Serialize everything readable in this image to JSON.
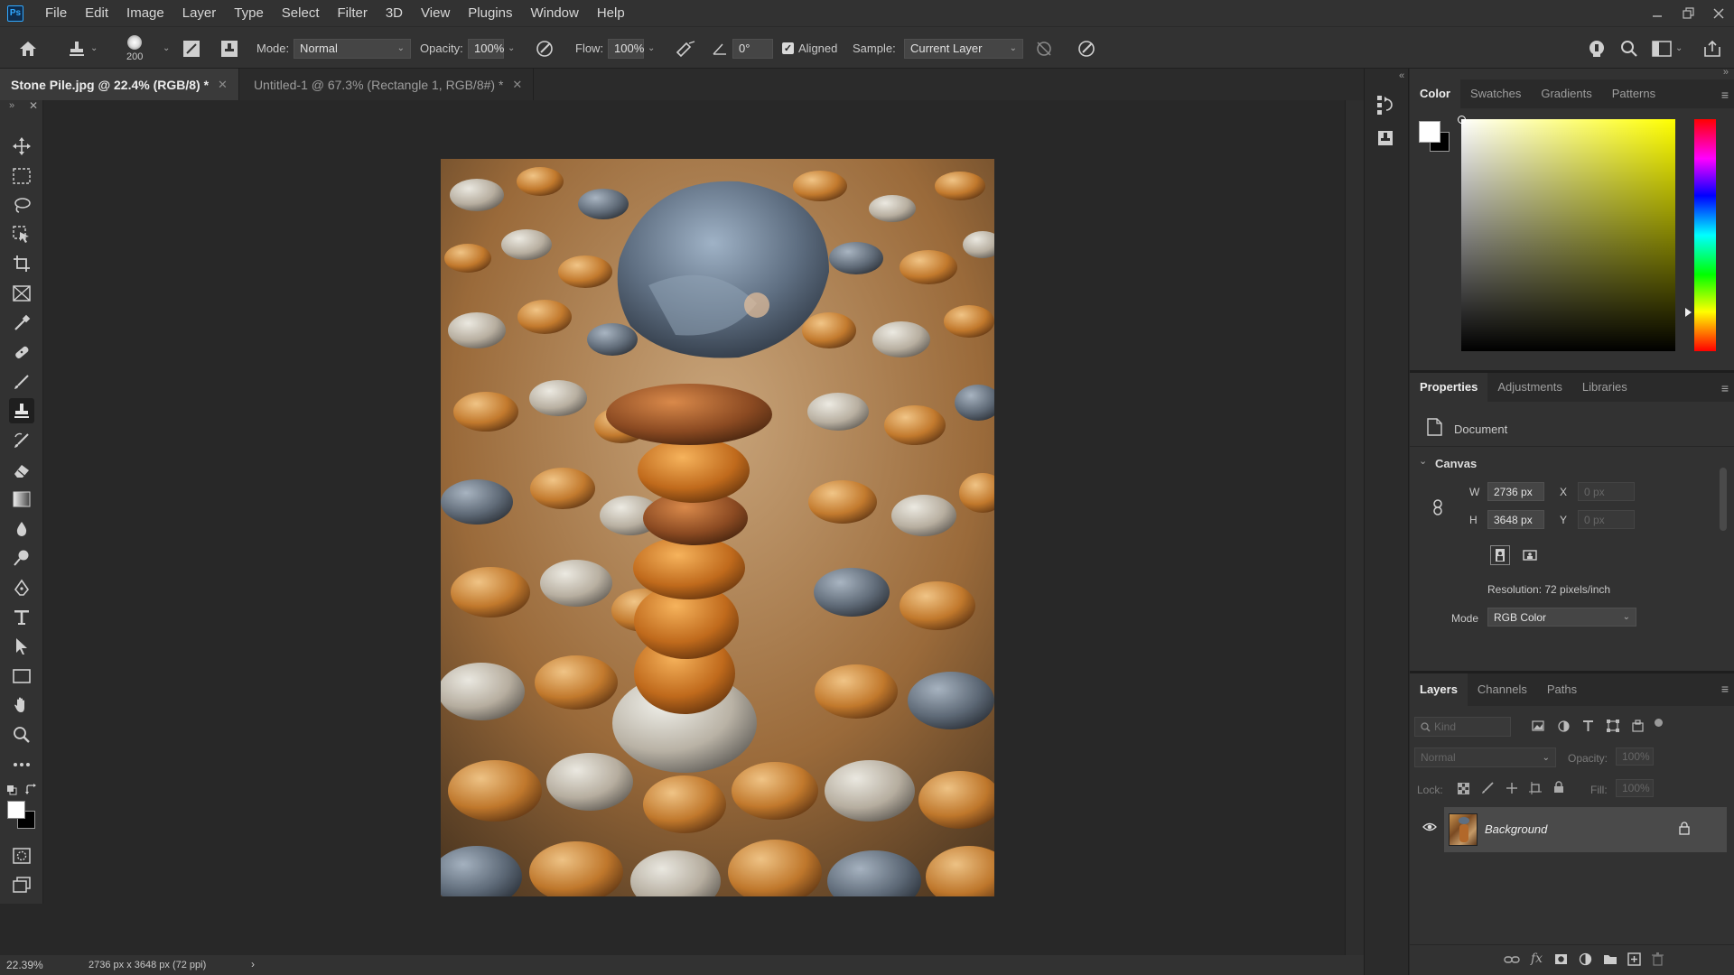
{
  "app": {
    "logo_text": "Ps"
  },
  "menu": [
    "File",
    "Edit",
    "Image",
    "Layer",
    "Type",
    "Select",
    "Filter",
    "3D",
    "View",
    "Plugins",
    "Window",
    "Help"
  ],
  "options_bar": {
    "brush_size": "200",
    "mode_label": "Mode:",
    "mode_value": "Normal",
    "opacity_label": "Opacity:",
    "opacity_value": "100%",
    "flow_label": "Flow:",
    "flow_value": "100%",
    "angle_value": "0°",
    "aligned_label": "Aligned",
    "aligned_checked": true,
    "sample_label": "Sample:",
    "sample_value": "Current Layer"
  },
  "tabs": [
    {
      "label": "Stone Pile.jpg @ 22.4% (RGB/8) *",
      "active": true
    },
    {
      "label": "Untitled-1 @ 67.3% (Rectangle 1, RGB/8#) *",
      "active": false
    }
  ],
  "status_bar": {
    "zoom": "22.39%",
    "doc_info": "2736 px x 3648 px (72 ppi)",
    "arrow": "›"
  },
  "color_panel": {
    "tabs": [
      "Color",
      "Swatches",
      "Gradients",
      "Patterns"
    ],
    "active_tab": "Color",
    "foreground": "#ffffff",
    "background": "#000000",
    "hue": "#ffff00"
  },
  "properties_panel": {
    "tabs": [
      "Properties",
      "Adjustments",
      "Libraries"
    ],
    "active_tab": "Properties",
    "document_label": "Document",
    "section_title": "Canvas",
    "w_label": "W",
    "w_value": "2736 px",
    "h_label": "H",
    "h_value": "3648 px",
    "x_label": "X",
    "x_value": "0 px",
    "y_label": "Y",
    "y_value": "0 px",
    "resolution": "Resolution: 72 pixels/inch",
    "mode_label": "Mode",
    "mode_value": "RGB Color"
  },
  "layers_panel": {
    "tabs": [
      "Layers",
      "Channels",
      "Paths"
    ],
    "active_tab": "Layers",
    "filter_placeholder": "Kind",
    "blend_mode": "Normal",
    "opacity_label": "Opacity:",
    "opacity_value": "100%",
    "lock_label": "Lock:",
    "fill_label": "Fill:",
    "fill_value": "100%",
    "layers": [
      {
        "name": "Background",
        "visible": true,
        "locked": true
      }
    ]
  },
  "colors": {
    "accent": "#31a8ff",
    "panel_bg": "#323232",
    "canvas_bg": "#282828"
  }
}
